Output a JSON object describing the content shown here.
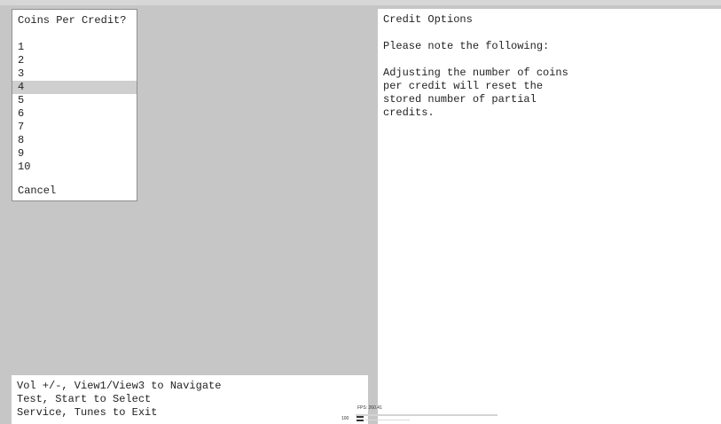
{
  "menu": {
    "title": "Coins Per Credit?",
    "options": [
      "1",
      "2",
      "3",
      "4",
      "5",
      "6",
      "7",
      "8",
      "9",
      "10"
    ],
    "selected_option": "4",
    "cancel_label": "Cancel"
  },
  "info": {
    "title": "Credit Options",
    "note": "Please note the following:",
    "body_lines": [
      "Adjusting the number of coins",
      "per credit will reset the",
      "stored number of partial",
      "credits."
    ]
  },
  "help": {
    "lines": [
      "Vol +/-, View1/View3 to Navigate",
      "Test, Start to Select",
      "Service, Tunes to Exit"
    ]
  },
  "fps": {
    "label": "FPS: 260.41",
    "scale_label": "100"
  },
  "colors": {
    "background": "#c6c6c6",
    "panel": "#ffffff",
    "selection": "#cfcfcf",
    "text": "#222222"
  }
}
